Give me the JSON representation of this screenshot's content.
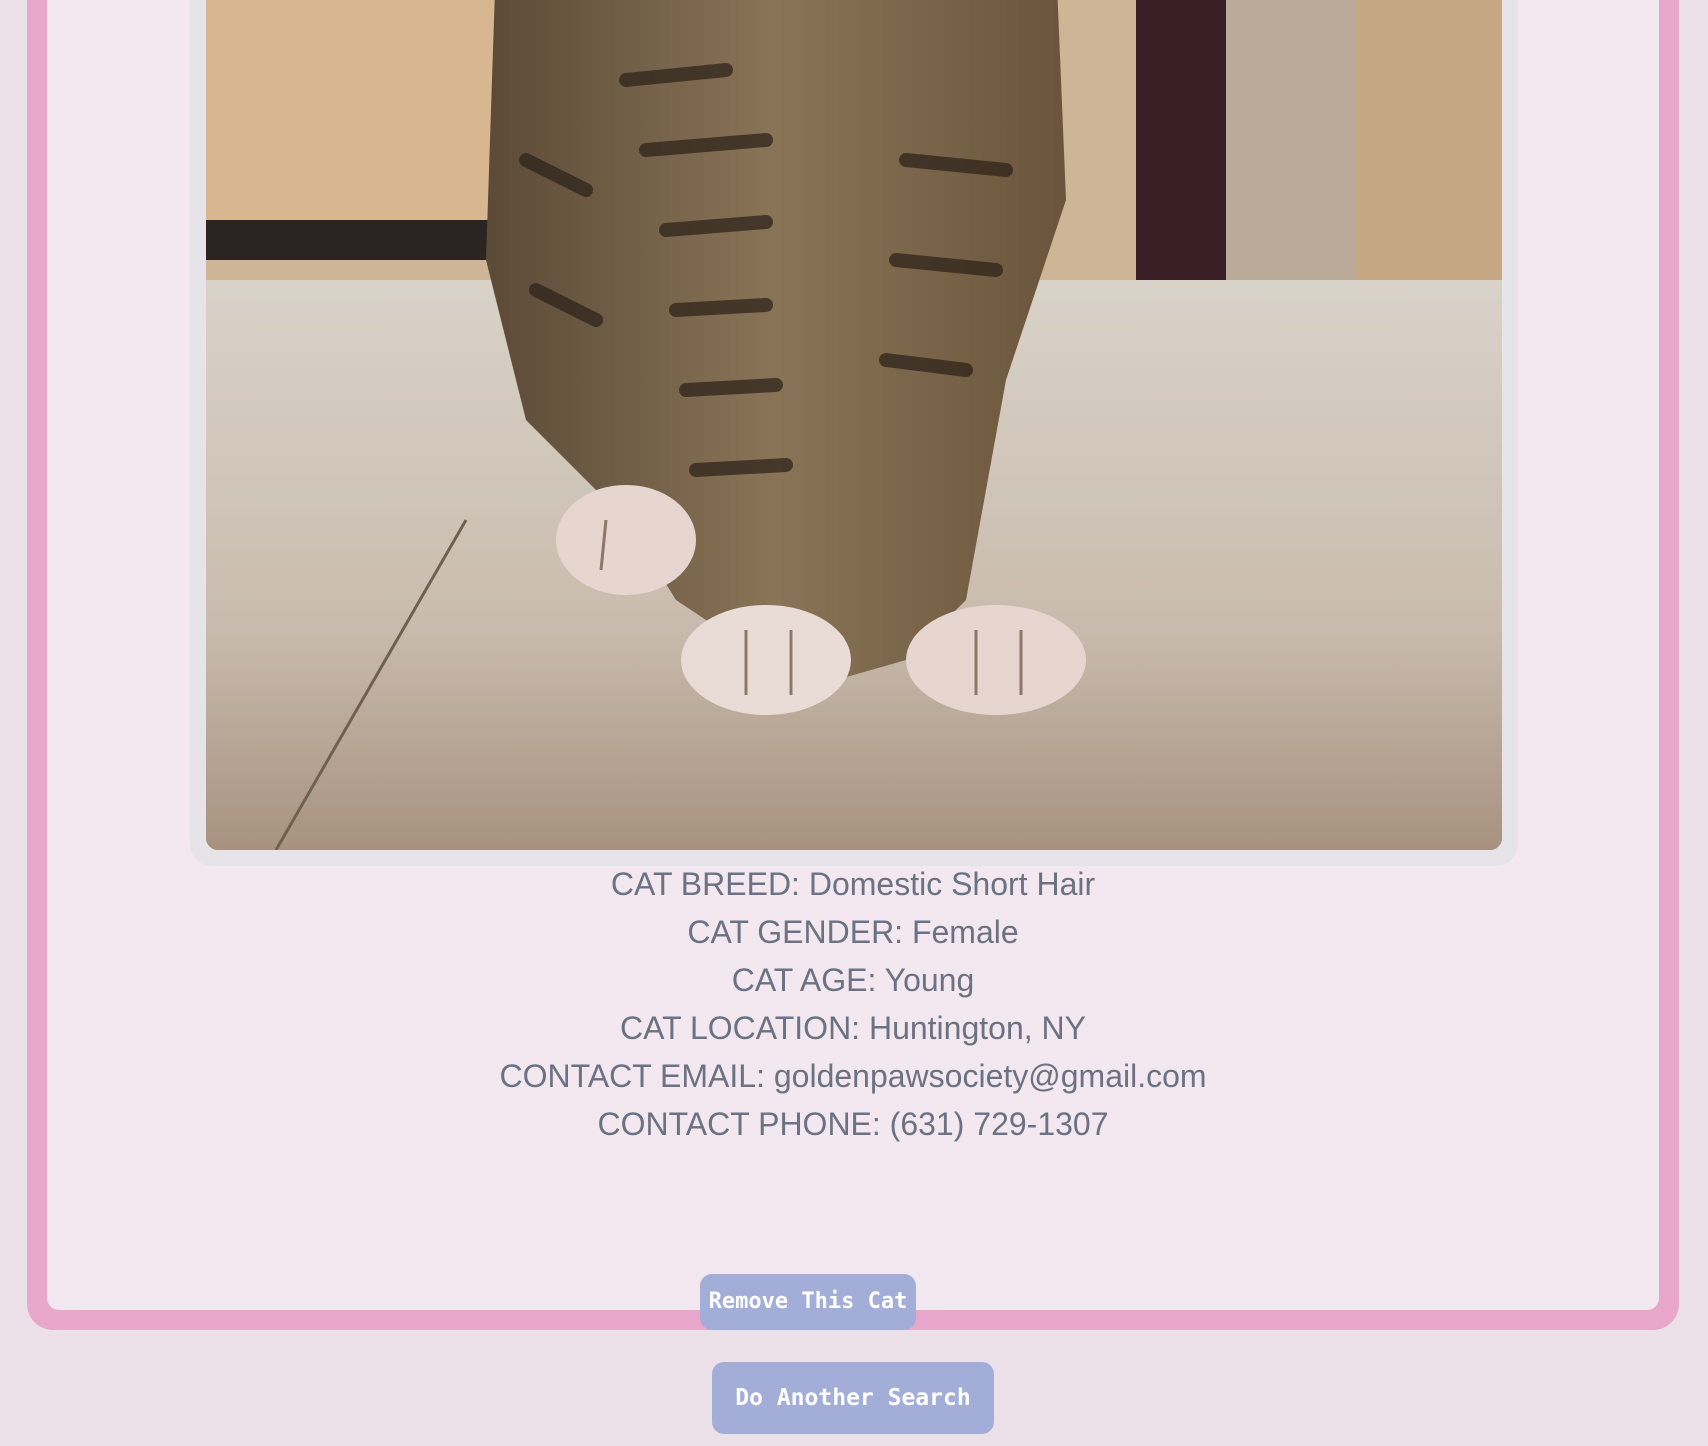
{
  "photo": {
    "alt": "Tabby kitten paws on floor"
  },
  "cat_details": {
    "breed": "CAT BREED: Domestic Short Hair",
    "gender": "CAT GENDER: Female",
    "age": "CAT AGE: Young",
    "location": "CAT LOCATION: Huntington, NY",
    "email": "CONTACT EMAIL: goldenpawsociety@gmail.com",
    "phone": "CONTACT PHONE: (631) 729-1307"
  },
  "actions": {
    "remove_label": "Remove This Cat",
    "search_label": "Do Another Search"
  },
  "colors": {
    "page_bg": "#ede1e9",
    "card_border": "#e9a8cb",
    "card_bg": "#f3e8ef",
    "button_bg": "#a3aed8",
    "text": "#6b7283"
  }
}
